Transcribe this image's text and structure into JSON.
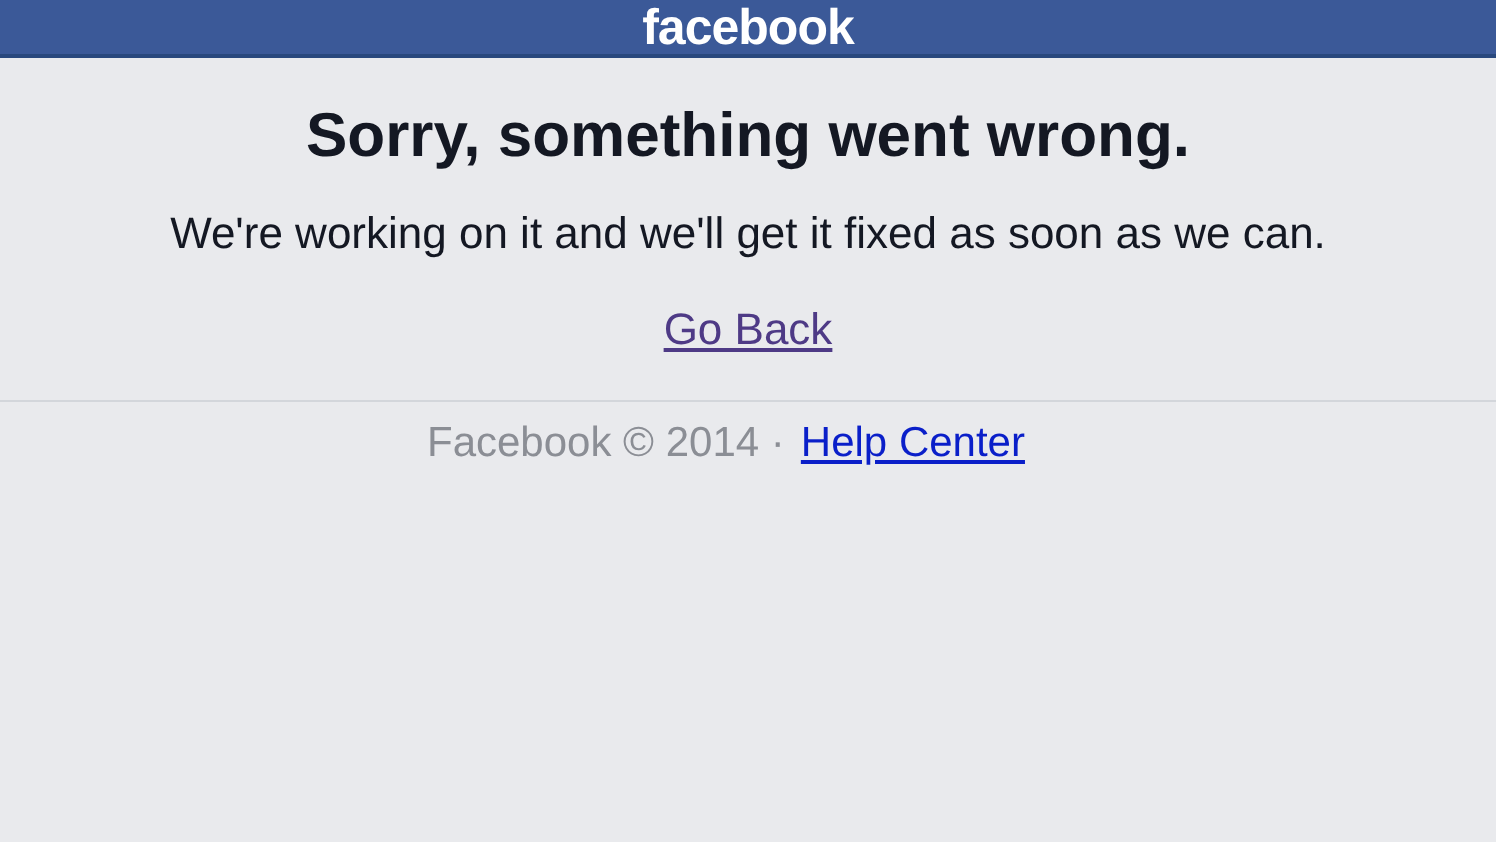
{
  "header": {
    "logo": "facebook"
  },
  "error": {
    "title": "Sorry, something went wrong.",
    "message": "We're working on it and we'll get it fixed as soon as we can.",
    "link": {
      "label": "Go Back",
      "visited": true
    }
  },
  "footer": {
    "copyright": "Facebook © 2014 ·",
    "link": {
      "label": "Help Center",
      "visited": false
    }
  }
}
